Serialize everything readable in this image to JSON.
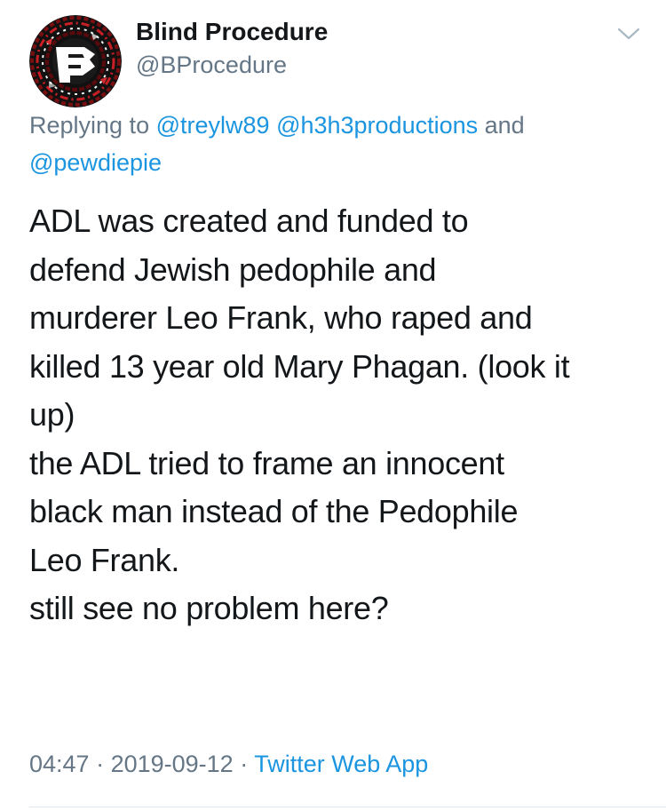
{
  "tweet": {
    "author": {
      "display_name": "Blind Procedure",
      "handle": "@BProcedure",
      "avatar_icon": "bp-logo-avatar-icon"
    },
    "menu_icon": "chevron-down-icon",
    "reply": {
      "prefix": "Replying to ",
      "mentions": [
        "@treylw89",
        "@h3h3productions"
      ],
      "joiner": " and ",
      "last_mention": "@pewdiepie"
    },
    "text_lines": [
      "ADL was created and funded to",
      "defend Jewish pedophile and",
      "murderer Leo Frank, who raped and",
      "killed 13 year old Mary Phagan. (look it",
      "up)",
      "the ADL tried to frame an innocent",
      "black man instead of the Pedophile",
      "Leo Frank.",
      "still see no problem here?"
    ],
    "time": "04:47",
    "separator": " · ",
    "date": "2019-09-12",
    "source": "Twitter Web App"
  },
  "colors": {
    "text": "#14171a",
    "secondary": "#657786",
    "link": "#1b95e0",
    "divider": "#e1e8ed"
  }
}
